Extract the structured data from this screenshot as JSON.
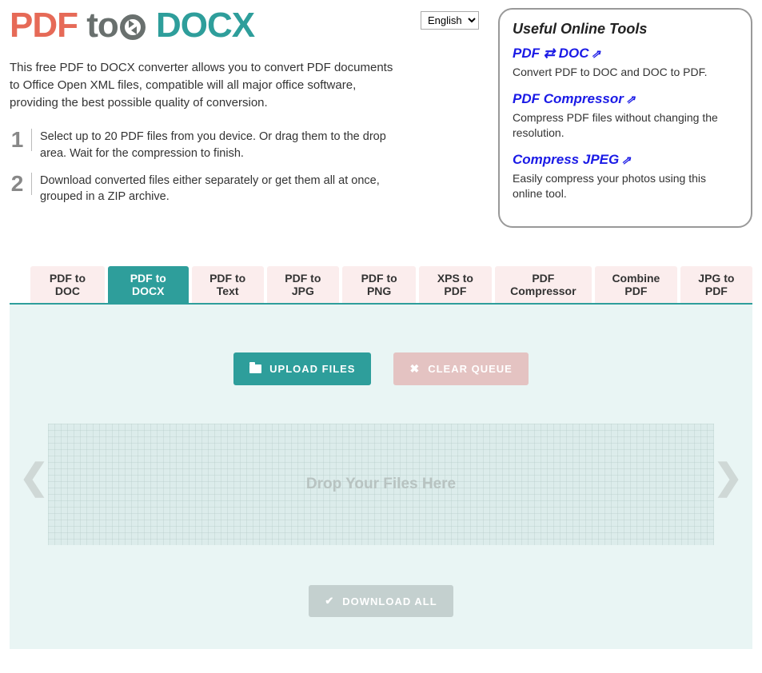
{
  "logo": {
    "part1": "PDF",
    "part2": "to",
    "part3": "DOCX"
  },
  "language": {
    "selected": "English"
  },
  "description": "This free PDF to DOCX converter allows you to convert PDF documents to Office Open XML files, compatible will all major office software, providing the best possible quality of conversion.",
  "steps": [
    {
      "num": "1",
      "text": "Select up to 20 PDF files from you device. Or drag them to the drop area. Wait for the compression to finish."
    },
    {
      "num": "2",
      "text": "Download converted files either separately or get them all at once, grouped in a ZIP archive."
    }
  ],
  "sidebar": {
    "title": "Useful Online Tools",
    "tools": [
      {
        "title": "PDF ⇄ DOC",
        "ext": "⇗",
        "desc": "Convert PDF to DOC and DOC to PDF."
      },
      {
        "title": "PDF Compressor",
        "ext": "⇗",
        "desc": "Compress PDF files without changing the resolution."
      },
      {
        "title": "Compress JPEG",
        "ext": "⇗",
        "desc": "Easily compress your photos using this online tool."
      }
    ]
  },
  "tabs": [
    "PDF to DOC",
    "PDF to DOCX",
    "PDF to Text",
    "PDF to JPG",
    "PDF to PNG",
    "XPS to PDF",
    "PDF Compressor",
    "Combine PDF",
    "JPG to PDF"
  ],
  "activeTabIndex": 1,
  "buttons": {
    "upload": "UPLOAD FILES",
    "clear": "CLEAR QUEUE",
    "download": "DOWNLOAD ALL"
  },
  "dropzone": {
    "text": "Drop Your Files Here"
  },
  "arrows": {
    "left": "❮",
    "right": "❯"
  }
}
